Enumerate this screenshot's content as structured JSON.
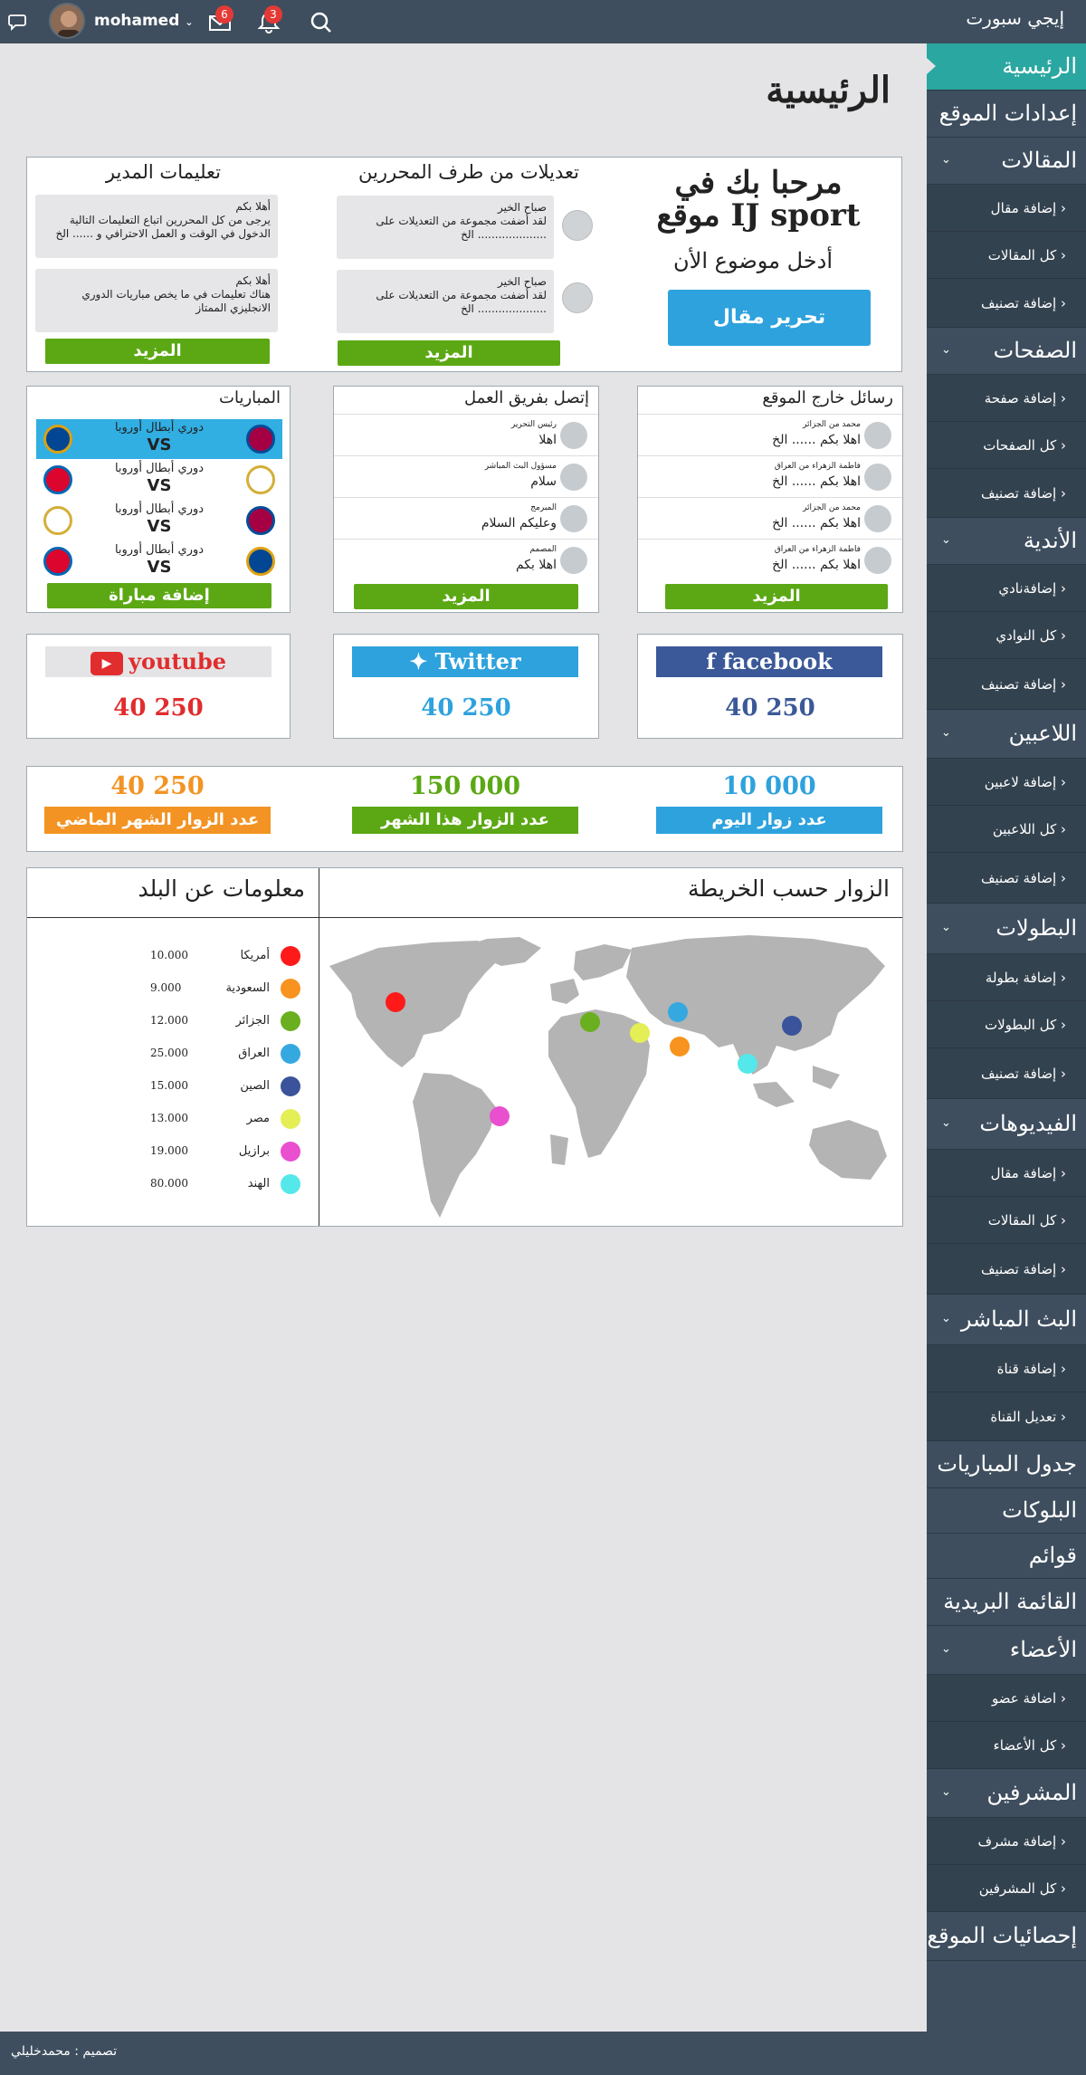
{
  "brand": "إيجي سبورت",
  "user": {
    "name": "mohamed",
    "mail_count": "6",
    "notif_count": "3"
  },
  "page_title": "الرئيسية",
  "sidebar": {
    "home": "الرئيسية",
    "settings": "إعدادات الموقع",
    "articles": {
      "label": "المقالات",
      "items": [
        "إضافة مقال",
        "كل المقالات",
        "إضافة تصنيف"
      ]
    },
    "pages": {
      "label": "الصفحات",
      "items": [
        "إضافة صفحة",
        "كل الصفحات",
        "إضافة تصنيف"
      ]
    },
    "clubs": {
      "label": "الأندية",
      "items": [
        "إضافةنادي",
        "كل النوادي",
        "إضافة تصنيف"
      ]
    },
    "players": {
      "label": "اللاعبين",
      "items": [
        "إضافة لاعبين",
        "كل اللاعبين",
        "إضافة تصنيف"
      ]
    },
    "leagues": {
      "label": "البطولات",
      "items": [
        "إضافة بطولة",
        "كل البطولات",
        "إضافة تصنيف"
      ]
    },
    "videos": {
      "label": "الفيديوهات",
      "items": [
        "إضافة مقال",
        "كل المقالات",
        "إضافة تصنيف"
      ]
    },
    "live": {
      "label": "البث المباشر",
      "items": [
        "إضافة قناة",
        "تعديل القناة"
      ]
    },
    "schedule": "جدول المباريات",
    "blocks": "البلوكات",
    "lists": "قوائم",
    "mailing": "القائمة البريدية",
    "members": {
      "label": "الأعضاء",
      "items": [
        "اضافة عضو",
        "كل الأعضاء"
      ]
    },
    "admins": {
      "label": "المشرفين",
      "items": [
        "إضافة مشرف",
        "كل المشرفين"
      ]
    },
    "stats": "إحصائيات الموقع"
  },
  "welcome": {
    "title": "مرحبا بك في موقع IJ sport",
    "subtitle": "أدخل موضوع الأن",
    "button": "تحرير مقال"
  },
  "editors": {
    "title": "تعديلات من طرف المحررين",
    "items": [
      {
        "greeting": "صباح الخير",
        "text": "لقد أضفت مجموعة من التعديلات على .................... الخ"
      },
      {
        "greeting": "صباح الخير",
        "text": "لقد أضفت مجموعة من التعديلات على .................... الخ"
      }
    ],
    "more": "المزيد"
  },
  "manager": {
    "title": "تعليمات المدير",
    "items": [
      {
        "greeting": "أهلا بكم",
        "text": "يرجى من كل المحررين اتباع التعليمات التالية الدخول في الوقت و العمل الاحترافي و ...... الخ"
      },
      {
        "greeting": "أهلا بكم",
        "text": "هناك تعليمات في ما يخص مباريات الدوري الانجليزي الممتاز"
      }
    ],
    "more": "المزيد"
  },
  "external_messages": {
    "title": "رسائل خارج الموقع",
    "items": [
      {
        "name": "محمد من الجزائر",
        "text": "اهلا بكم ...... الخ"
      },
      {
        "name": "فاطمة الزهراء من العراق",
        "text": "اهلا بكم ...... الخ"
      },
      {
        "name": "محمد من الجزائر",
        "text": "اهلا بكم ...... الخ"
      },
      {
        "name": "فاطمة الزهراء من العراق",
        "text": "اهلا بكم ...... الخ"
      }
    ],
    "more": "المزيد"
  },
  "team_contact": {
    "title": "إتصل بفريق العمل",
    "items": [
      {
        "name": "رئيس التحرير",
        "text": "اهلا"
      },
      {
        "name": "مسؤول البث المباشر",
        "text": "سلام"
      },
      {
        "name": "المبرمج",
        "text": "وعليكم السلام"
      },
      {
        "name": "المصمم",
        "text": "اهلا بكم"
      }
    ],
    "more": "المزيد"
  },
  "matches": {
    "title": "المباريات",
    "items": [
      {
        "name": "دوري أبطال أوروبا",
        "vs": "VS"
      },
      {
        "name": "دوري أبطال أوروبا",
        "vs": "VS"
      },
      {
        "name": "دوري أبطال أوروبا",
        "vs": "VS"
      },
      {
        "name": "دوري أبطال أوروبا",
        "vs": "VS"
      }
    ],
    "add": "إضافة مباراة"
  },
  "social": {
    "facebook": {
      "label": "facebook",
      "count": "40 250",
      "color": "#3b5998"
    },
    "twitter": {
      "label": "Twitter",
      "count": "40 250",
      "color": "#2ea2dd"
    },
    "youtube": {
      "label": "youtube",
      "count": "40 250",
      "color": "#e12d2d"
    }
  },
  "stats": {
    "today": {
      "value": "10 000",
      "label": "عدد زوار اليوم",
      "color": "#2ea2dd"
    },
    "month": {
      "value": "150 000",
      "label": "عدد الزوار هذا الشهر",
      "color": "#5ba814"
    },
    "last_month": {
      "value": "40 250",
      "label": "عدد الزوار الشهر الماضي",
      "color": "#f39323"
    }
  },
  "map_title": "الزوار حسب الخريطة",
  "country_title": "معلومات عن البلد",
  "countries": [
    {
      "name": "أمريكا",
      "value": "10.000",
      "color": "#ff1a1a"
    },
    {
      "name": "السعودية",
      "value": "9.000",
      "color": "#f7931e"
    },
    {
      "name": "الجزائر",
      "value": "12.000",
      "color": "#6aaf1f"
    },
    {
      "name": "العراق",
      "value": "25.000",
      "color": "#36a8e0"
    },
    {
      "name": "الصين",
      "value": "15.000",
      "color": "#3a539b"
    },
    {
      "name": "مصر",
      "value": "13.000",
      "color": "#e4ee55"
    },
    {
      "name": "برازيل",
      "value": "19.000",
      "color": "#e94fcf"
    },
    {
      "name": "الهند",
      "value": "80.000",
      "color": "#55e8ea"
    }
  ],
  "footer": "تصميم : محمدخليلي"
}
